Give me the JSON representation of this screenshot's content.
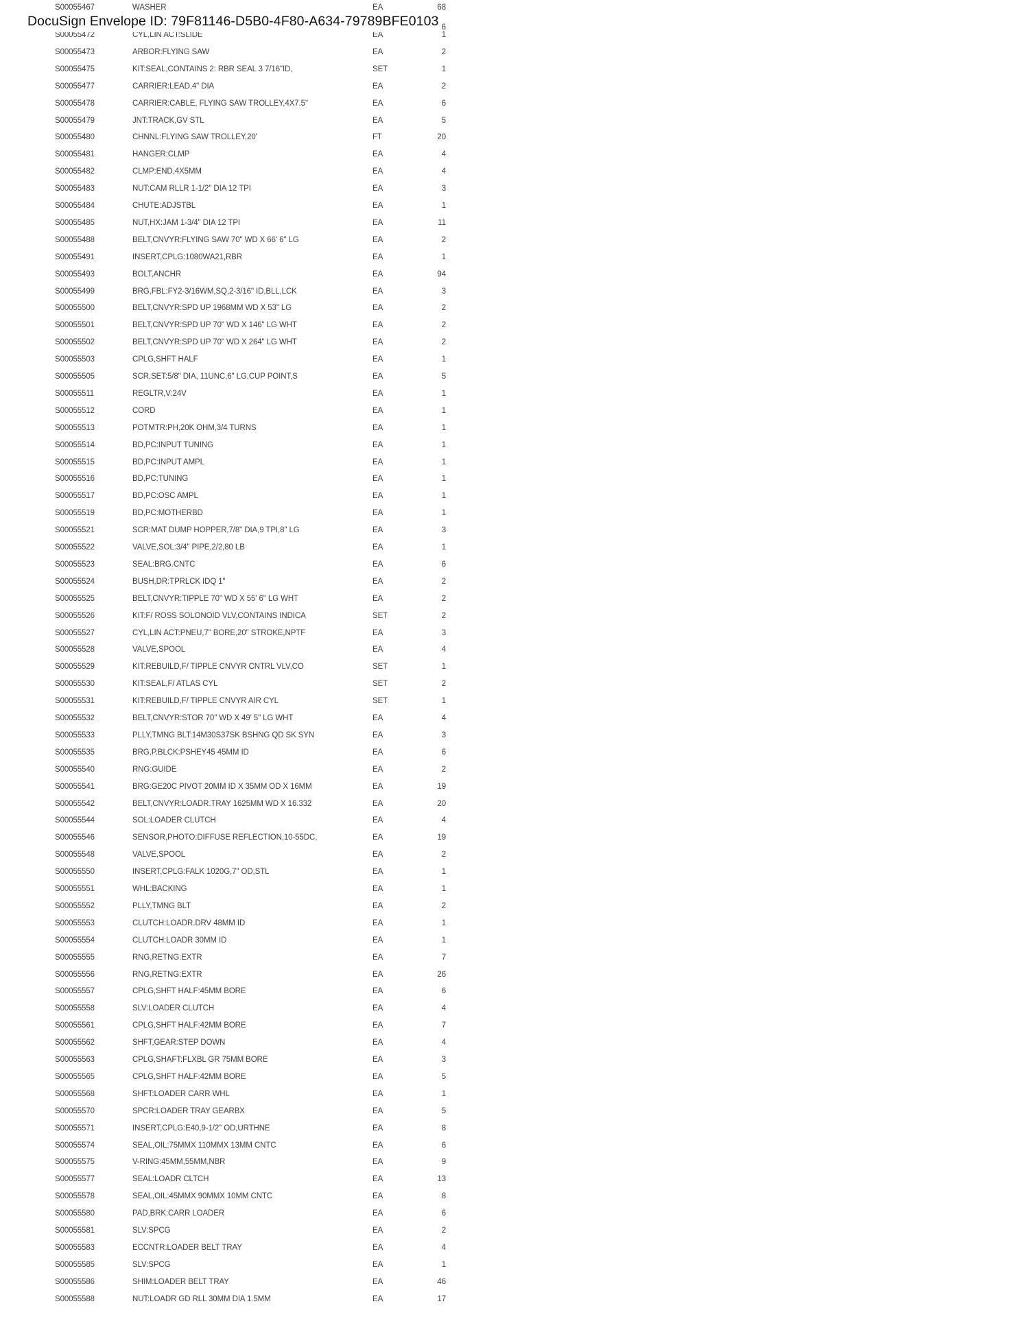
{
  "envelope": {
    "label": "DocuSign Envelope ID: 79F81146-D5B0-4F80-A634-79789BFE0103"
  },
  "partial_row_qty": "6",
  "items": [
    {
      "item": "S00055467",
      "description": "WASHER",
      "uom": "EA",
      "qty": "68"
    },
    {
      "item": "S00055472",
      "description": "CYL,LIN ACT:SLIDE",
      "uom": "EA",
      "qty": "1"
    },
    {
      "item": "S00055473",
      "description": "ARBOR:FLYING SAW",
      "uom": "EA",
      "qty": "2"
    },
    {
      "item": "S00055475",
      "description": "KIT:SEAL,CONTAINS 2: RBR SEAL 3 7/16\"ID,",
      "uom": "SET",
      "qty": "1"
    },
    {
      "item": "S00055477",
      "description": "CARRIER:LEAD,4\" DIA",
      "uom": "EA",
      "qty": "2"
    },
    {
      "item": "S00055478",
      "description": "CARRIER:CABLE, FLYING SAW TROLLEY,4X7.5\"",
      "uom": "EA",
      "qty": "6"
    },
    {
      "item": "S00055479",
      "description": "JNT:TRACK,GV STL",
      "uom": "EA",
      "qty": "5"
    },
    {
      "item": "S00055480",
      "description": "CHNNL:FLYING SAW TROLLEY,20'",
      "uom": "FT",
      "qty": "20"
    },
    {
      "item": "S00055481",
      "description": "HANGER:CLMP",
      "uom": "EA",
      "qty": "4"
    },
    {
      "item": "S00055482",
      "description": "CLMP:END,4X5MM",
      "uom": "EA",
      "qty": "4"
    },
    {
      "item": "S00055483",
      "description": "NUT:CAM RLLR 1-1/2\" DIA 12 TPI",
      "uom": "EA",
      "qty": "3"
    },
    {
      "item": "S00055484",
      "description": "CHUTE:ADJSTBL",
      "uom": "EA",
      "qty": "1"
    },
    {
      "item": "S00055485",
      "description": "NUT,HX:JAM 1-3/4\" DIA 12 TPI",
      "uom": "EA",
      "qty": "11"
    },
    {
      "item": "S00055488",
      "description": "BELT,CNVYR:FLYING SAW 70\" WD X 66' 6\" LG",
      "uom": "EA",
      "qty": "2"
    },
    {
      "item": "S00055491",
      "description": "INSERT,CPLG:1080WA21,RBR",
      "uom": "EA",
      "qty": "1"
    },
    {
      "item": "S00055493",
      "description": "BOLT,ANCHR",
      "uom": "EA",
      "qty": "94"
    },
    {
      "item": "S00055499",
      "description": "BRG,FBL:FY2-3/16WM,SQ,2-3/16\" ID,BLL,LCK",
      "uom": "EA",
      "qty": "3"
    },
    {
      "item": "S00055500",
      "description": "BELT,CNVYR:SPD UP 1968MM WD X 53\" LG",
      "uom": "EA",
      "qty": "2"
    },
    {
      "item": "S00055501",
      "description": "BELT,CNVYR:SPD UP 70\" WD X 146\" LG WHT",
      "uom": "EA",
      "qty": "2"
    },
    {
      "item": "S00055502",
      "description": "BELT,CNVYR:SPD UP 70\" WD X 264\" LG WHT",
      "uom": "EA",
      "qty": "2"
    },
    {
      "item": "S00055503",
      "description": "CPLG,SHFT HALF",
      "uom": "EA",
      "qty": "1"
    },
    {
      "item": "S00055505",
      "description": "SCR,SET:5/8\" DIA, 11UNC,6\" LG,CUP POINT,S",
      "uom": "EA",
      "qty": "5"
    },
    {
      "item": "S00055511",
      "description": "REGLTR,V:24V",
      "uom": "EA",
      "qty": "1"
    },
    {
      "item": "S00055512",
      "description": "CORD",
      "uom": "EA",
      "qty": "1"
    },
    {
      "item": "S00055513",
      "description": "POTMTR:PH,20K OHM,3/4 TURNS",
      "uom": "EA",
      "qty": "1"
    },
    {
      "item": "S00055514",
      "description": "BD,PC:INPUT TUNING",
      "uom": "EA",
      "qty": "1"
    },
    {
      "item": "S00055515",
      "description": "BD,PC:INPUT AMPL",
      "uom": "EA",
      "qty": "1"
    },
    {
      "item": "S00055516",
      "description": "BD,PC:TUNING",
      "uom": "EA",
      "qty": "1"
    },
    {
      "item": "S00055517",
      "description": "BD,PC:OSC AMPL",
      "uom": "EA",
      "qty": "1"
    },
    {
      "item": "S00055519",
      "description": "BD,PC:MOTHERBD",
      "uom": "EA",
      "qty": "1"
    },
    {
      "item": "S00055521",
      "description": "SCR:MAT DUMP HOPPER,7/8\" DIA,9 TPI,8\" LG",
      "uom": "EA",
      "qty": "3"
    },
    {
      "item": "S00055522",
      "description": "VALVE,SOL:3/4\" PIPE,2/2,80 LB",
      "uom": "EA",
      "qty": "1"
    },
    {
      "item": "S00055523",
      "description": "SEAL:BRG.CNTC",
      "uom": "EA",
      "qty": "6"
    },
    {
      "item": "S00055524",
      "description": "BUSH,DR:TPRLCK IDQ 1\"",
      "uom": "EA",
      "qty": "2"
    },
    {
      "item": "S00055525",
      "description": "BELT,CNVYR:TIPPLE 70\" WD X 55' 6\" LG WHT",
      "uom": "EA",
      "qty": "2"
    },
    {
      "item": "S00055526",
      "description": "KIT:F/ ROSS SOLONOID VLV,CONTAINS INDICA",
      "uom": "SET",
      "qty": "2"
    },
    {
      "item": "S00055527",
      "description": "CYL,LIN ACT:PNEU,7\" BORE,20\" STROKE,NPTF",
      "uom": "EA",
      "qty": "3"
    },
    {
      "item": "S00055528",
      "description": "VALVE,SPOOL",
      "uom": "EA",
      "qty": "4"
    },
    {
      "item": "S00055529",
      "description": "KIT:REBUILD,F/ TIPPLE CNVYR CNTRL VLV,CO",
      "uom": "SET",
      "qty": "1"
    },
    {
      "item": "S00055530",
      "description": "KIT:SEAL,F/ ATLAS CYL",
      "uom": "SET",
      "qty": "2"
    },
    {
      "item": "S00055531",
      "description": "KIT:REBUILD,F/ TIPPLE CNVYR AIR CYL",
      "uom": "SET",
      "qty": "1"
    },
    {
      "item": "S00055532",
      "description": "BELT,CNVYR:STOR 70\" WD X 49' 5\" LG WHT",
      "uom": "EA",
      "qty": "4"
    },
    {
      "item": "S00055533",
      "description": "PLLY,TMNG BLT:14M30S37SK BSHNG QD SK SYN",
      "uom": "EA",
      "qty": "3"
    },
    {
      "item": "S00055535",
      "description": "BRG,P.BLCK:PSHEY45 45MM ID",
      "uom": "EA",
      "qty": "6"
    },
    {
      "item": "S00055540",
      "description": "RNG:GUIDE",
      "uom": "EA",
      "qty": "2"
    },
    {
      "item": "S00055541",
      "description": "BRG:GE20C PIVOT 20MM ID X 35MM OD X 16MM",
      "uom": "EA",
      "qty": "19"
    },
    {
      "item": "S00055542",
      "description": "BELT,CNVYR:LOADR.TRAY 1625MM WD X 16.332",
      "uom": "EA",
      "qty": "20"
    },
    {
      "item": "S00055544",
      "description": "SOL:LOADER CLUTCH",
      "uom": "EA",
      "qty": "4"
    },
    {
      "item": "S00055546",
      "description": "SENSOR,PHOTO:DIFFUSE REFLECTION,10-55DC,",
      "uom": "EA",
      "qty": "19"
    },
    {
      "item": "S00055548",
      "description": "VALVE,SPOOL",
      "uom": "EA",
      "qty": "2"
    },
    {
      "item": "S00055550",
      "description": "INSERT,CPLG:FALK 1020G,7\" OD,STL",
      "uom": "EA",
      "qty": "1"
    },
    {
      "item": "S00055551",
      "description": "WHL:BACKING",
      "uom": "EA",
      "qty": "1"
    },
    {
      "item": "S00055552",
      "description": "PLLY,TMNG BLT",
      "uom": "EA",
      "qty": "2"
    },
    {
      "item": "S00055553",
      "description": "CLUTCH:LOADR.DRV 48MM ID",
      "uom": "EA",
      "qty": "1"
    },
    {
      "item": "S00055554",
      "description": "CLUTCH:LOADR 30MM ID",
      "uom": "EA",
      "qty": "1"
    },
    {
      "item": "S00055555",
      "description": "RNG,RETNG:EXTR",
      "uom": "EA",
      "qty": "7"
    },
    {
      "item": "S00055556",
      "description": "RNG,RETNG:EXTR",
      "uom": "EA",
      "qty": "26"
    },
    {
      "item": "S00055557",
      "description": "CPLG,SHFT HALF:45MM BORE",
      "uom": "EA",
      "qty": "6"
    },
    {
      "item": "S00055558",
      "description": "SLV:LOADER CLUTCH",
      "uom": "EA",
      "qty": "4"
    },
    {
      "item": "S00055561",
      "description": "CPLG,SHFT HALF:42MM BORE",
      "uom": "EA",
      "qty": "7"
    },
    {
      "item": "S00055562",
      "description": "SHFT,GEAR:STEP DOWN",
      "uom": "EA",
      "qty": "4"
    },
    {
      "item": "S00055563",
      "description": "CPLG,SHAFT:FLXBL GR 75MM BORE",
      "uom": "EA",
      "qty": "3"
    },
    {
      "item": "S00055565",
      "description": "CPLG,SHFT HALF:42MM BORE",
      "uom": "EA",
      "qty": "5"
    },
    {
      "item": "S00055568",
      "description": "SHFT:LOADER CARR WHL",
      "uom": "EA",
      "qty": "1"
    },
    {
      "item": "S00055570",
      "description": "SPCR:LOADER TRAY GEARBX",
      "uom": "EA",
      "qty": "5"
    },
    {
      "item": "S00055571",
      "description": "INSERT,CPLG:E40,9-1/2\" OD,URTHNE",
      "uom": "EA",
      "qty": "8"
    },
    {
      "item": "S00055574",
      "description": "SEAL,OIL:75MMX 110MMX 13MM CNTC",
      "uom": "EA",
      "qty": "6"
    },
    {
      "item": "S00055575",
      "description": "V-RING:45MM,55MM,NBR",
      "uom": "EA",
      "qty": "9"
    },
    {
      "item": "S00055577",
      "description": "SEAL:LOADR CLTCH",
      "uom": "EA",
      "qty": "13"
    },
    {
      "item": "S00055578",
      "description": "SEAL,OIL:45MMX 90MMX 10MM CNTC",
      "uom": "EA",
      "qty": "8"
    },
    {
      "item": "S00055580",
      "description": "PAD,BRK:CARR LOADER",
      "uom": "EA",
      "qty": "6"
    },
    {
      "item": "S00055581",
      "description": "SLV:SPCG",
      "uom": "EA",
      "qty": "2"
    },
    {
      "item": "S00055583",
      "description": "ECCNTR:LOADER BELT TRAY",
      "uom": "EA",
      "qty": "4"
    },
    {
      "item": "S00055585",
      "description": "SLV:SPCG",
      "uom": "EA",
      "qty": "1"
    },
    {
      "item": "S00055586",
      "description": "SHIM:LOADER BELT TRAY",
      "uom": "EA",
      "qty": "46"
    },
    {
      "item": "S00055588",
      "description": "NUT:LOADR GD RLL 30MM DIA 1.5MM",
      "uom": "EA",
      "qty": "17"
    }
  ]
}
